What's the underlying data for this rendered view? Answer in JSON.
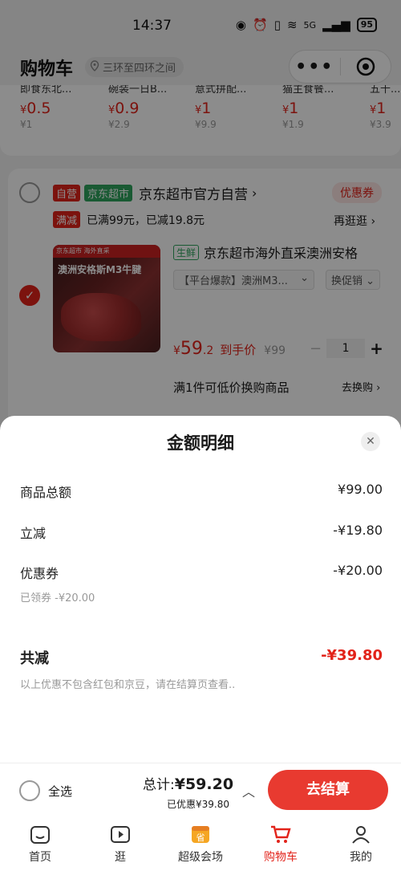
{
  "status_bar": {
    "time": "14:37",
    "signal": "5G",
    "battery": "95"
  },
  "header": {
    "title": "购物车",
    "location": "三环至四环之间"
  },
  "recommend": [
    {
      "name": "即食东北...",
      "price": "0.5",
      "orig": "¥1"
    },
    {
      "name": "碗装一日B...",
      "price": "0.9",
      "orig": "¥2.9"
    },
    {
      "name": "意式拼配...",
      "price": "1",
      "orig": "¥9.9"
    },
    {
      "name": "猫主食餐...",
      "price": "1",
      "orig": "¥1.9"
    },
    {
      "name": "五十...",
      "price": "1",
      "orig": "¥3.9"
    }
  ],
  "store": {
    "tag_self": "自营",
    "tag_super": "京东超市",
    "name": "京东超市官方自营",
    "coupon": "优惠券",
    "promo_tag": "满减",
    "promo_text": "已满99元，已减19.8元",
    "promo_link": "再逛逛 ›",
    "product": {
      "fresh_tag": "生鲜",
      "title": "京东超市海外直采澳洲安格",
      "image_caption": "澳洲安格斯M3牛腱",
      "image_band": "京东超市 海外直采",
      "spec": "【平台爆款】澳洲M3...",
      "promo_select": "换促销",
      "price_int": "59",
      "price_dec": ".2",
      "price_label": "到手价",
      "orig_price": "¥99",
      "qty": "1",
      "minus": "−",
      "plus": "+"
    },
    "swap_text": "满1件可低价换购商品",
    "swap_link": "去换购 ›"
  },
  "sheet": {
    "title": "金额明细",
    "rows": [
      {
        "label": "商品总额",
        "value": "¥99.00"
      },
      {
        "label": "立减",
        "value": "-¥19.80"
      },
      {
        "label": "优惠券",
        "value": "-¥20.00"
      }
    ],
    "coupon_sub": "已领券 -¥20.00",
    "total_label": "共减",
    "total_value": "-¥39.80",
    "note": "以上优惠不包含红包和京豆，请在结算页查看.."
  },
  "actionbar": {
    "select_all": "全选",
    "total_label": "总计:",
    "total_value": "¥59.20",
    "saved": "已优惠¥39.80",
    "checkout": "去结算"
  },
  "tabs": [
    {
      "label": "首页",
      "icon": "home-icon"
    },
    {
      "label": "逛",
      "icon": "video-icon"
    },
    {
      "label": "超级会场",
      "icon": "calendar-icon"
    },
    {
      "label": "购物车",
      "icon": "cart-icon"
    },
    {
      "label": "我的",
      "icon": "user-icon"
    }
  ],
  "colors": {
    "brand_red": "#e2231a",
    "green": "#2fa45e"
  }
}
